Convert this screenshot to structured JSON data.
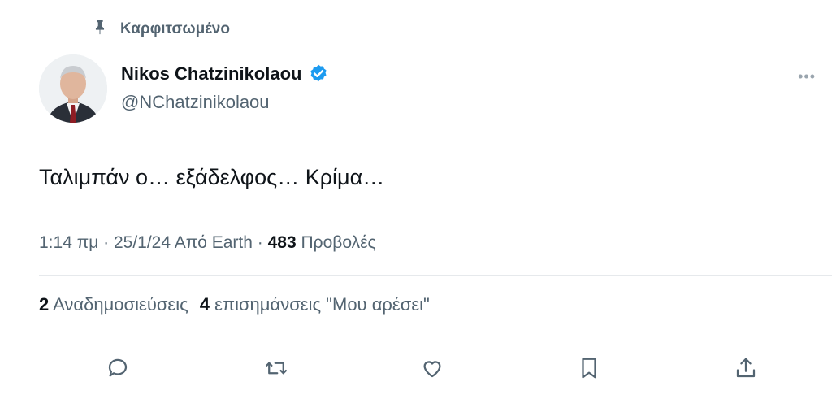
{
  "pinned": {
    "label": "Καρφιτσωμένο",
    "icon": "pin-icon"
  },
  "author": {
    "name": "Nikos Chatzinikolaou",
    "handle": "@NChatzinikolaou",
    "verified": true,
    "verified_color": "#1d9bf0"
  },
  "tweet": {
    "text": "Ταλιμπάν ο… εξάδελφος… Κρίμα…"
  },
  "meta": {
    "time": "1:14 πμ",
    "date": "25/1/24",
    "source": "Από Earth",
    "views_count": "483",
    "views_label": "Προβολές"
  },
  "stats": {
    "reposts_count": "2",
    "reposts_label": "Αναδημοσιεύσεις",
    "likes_count": "4",
    "likes_label": "επισημάνσεις \"Μου αρέσει\""
  },
  "actions": [
    "reply-icon",
    "repost-icon",
    "like-icon",
    "bookmark-icon",
    "share-icon"
  ],
  "colors": {
    "secondary_text": "#536471",
    "icon": "#536471",
    "primary_text": "#0f1419"
  }
}
